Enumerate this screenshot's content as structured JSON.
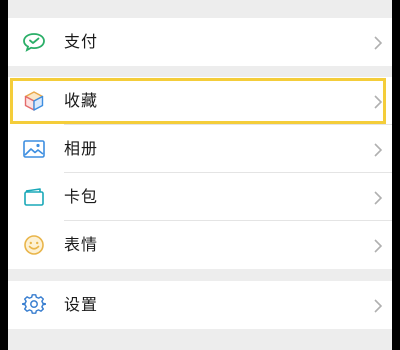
{
  "menu": {
    "pay": {
      "label": "支付",
      "icon": "wechat-pay-icon"
    },
    "favorites": {
      "label": "收藏",
      "icon": "cube-icon"
    },
    "album": {
      "label": "相册",
      "icon": "image-icon"
    },
    "cards": {
      "label": "卡包",
      "icon": "card-icon"
    },
    "stickers": {
      "label": "表情",
      "icon": "smiley-icon"
    },
    "settings": {
      "label": "设置",
      "icon": "gear-icon"
    }
  },
  "colors": {
    "highlight": "#f4cd3a",
    "background": "#ededed",
    "pay_green": "#2aae67",
    "album_blue": "#3d8ee0",
    "cards_teal": "#19a8b8",
    "sticker_yellow": "#e9b54a",
    "settings_blue": "#3a7fd0"
  }
}
